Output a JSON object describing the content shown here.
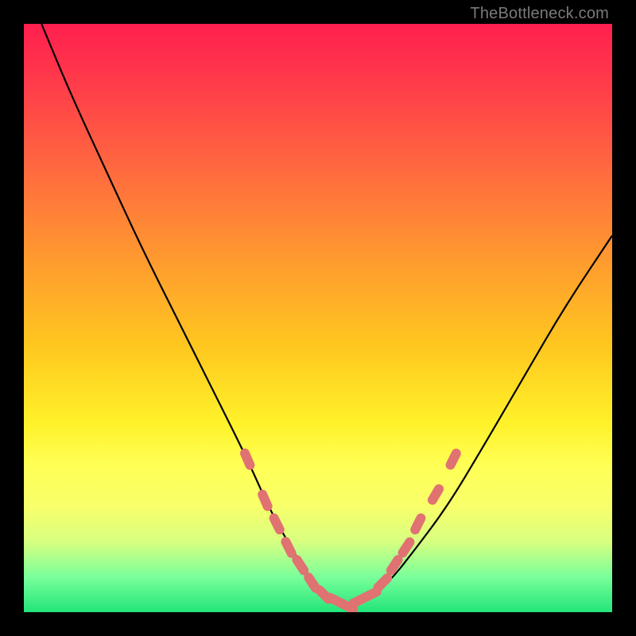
{
  "watermark": "TheBottleneck.com",
  "chart_data": {
    "type": "line",
    "title": "",
    "xlabel": "",
    "ylabel": "",
    "xlim": [
      0,
      100
    ],
    "ylim": [
      0,
      100
    ],
    "grid": false,
    "legend": false,
    "series": [
      {
        "name": "bottleneck-curve",
        "color": "#000000",
        "x": [
          3,
          8,
          14,
          20,
          26,
          32,
          38,
          42,
          46,
          49,
          52,
          55,
          58,
          62,
          66,
          72,
          78,
          85,
          92,
          100
        ],
        "y": [
          100,
          88,
          75,
          62,
          50,
          38,
          26,
          17,
          10,
          5,
          2,
          1,
          2,
          5,
          10,
          18,
          28,
          40,
          52,
          64
        ]
      }
    ],
    "annotations": {
      "name": "valley-markers",
      "marker_color": "#e07272",
      "points": [
        {
          "x": 38,
          "y": 26
        },
        {
          "x": 41,
          "y": 19
        },
        {
          "x": 43,
          "y": 15
        },
        {
          "x": 45,
          "y": 11
        },
        {
          "x": 47,
          "y": 8
        },
        {
          "x": 49,
          "y": 5
        },
        {
          "x": 51,
          "y": 3
        },
        {
          "x": 53,
          "y": 2
        },
        {
          "x": 55,
          "y": 1
        },
        {
          "x": 57,
          "y": 2
        },
        {
          "x": 59,
          "y": 3
        },
        {
          "x": 61,
          "y": 5
        },
        {
          "x": 63,
          "y": 8
        },
        {
          "x": 65,
          "y": 11
        },
        {
          "x": 67,
          "y": 15
        },
        {
          "x": 70,
          "y": 20
        },
        {
          "x": 73,
          "y": 26
        }
      ]
    }
  }
}
